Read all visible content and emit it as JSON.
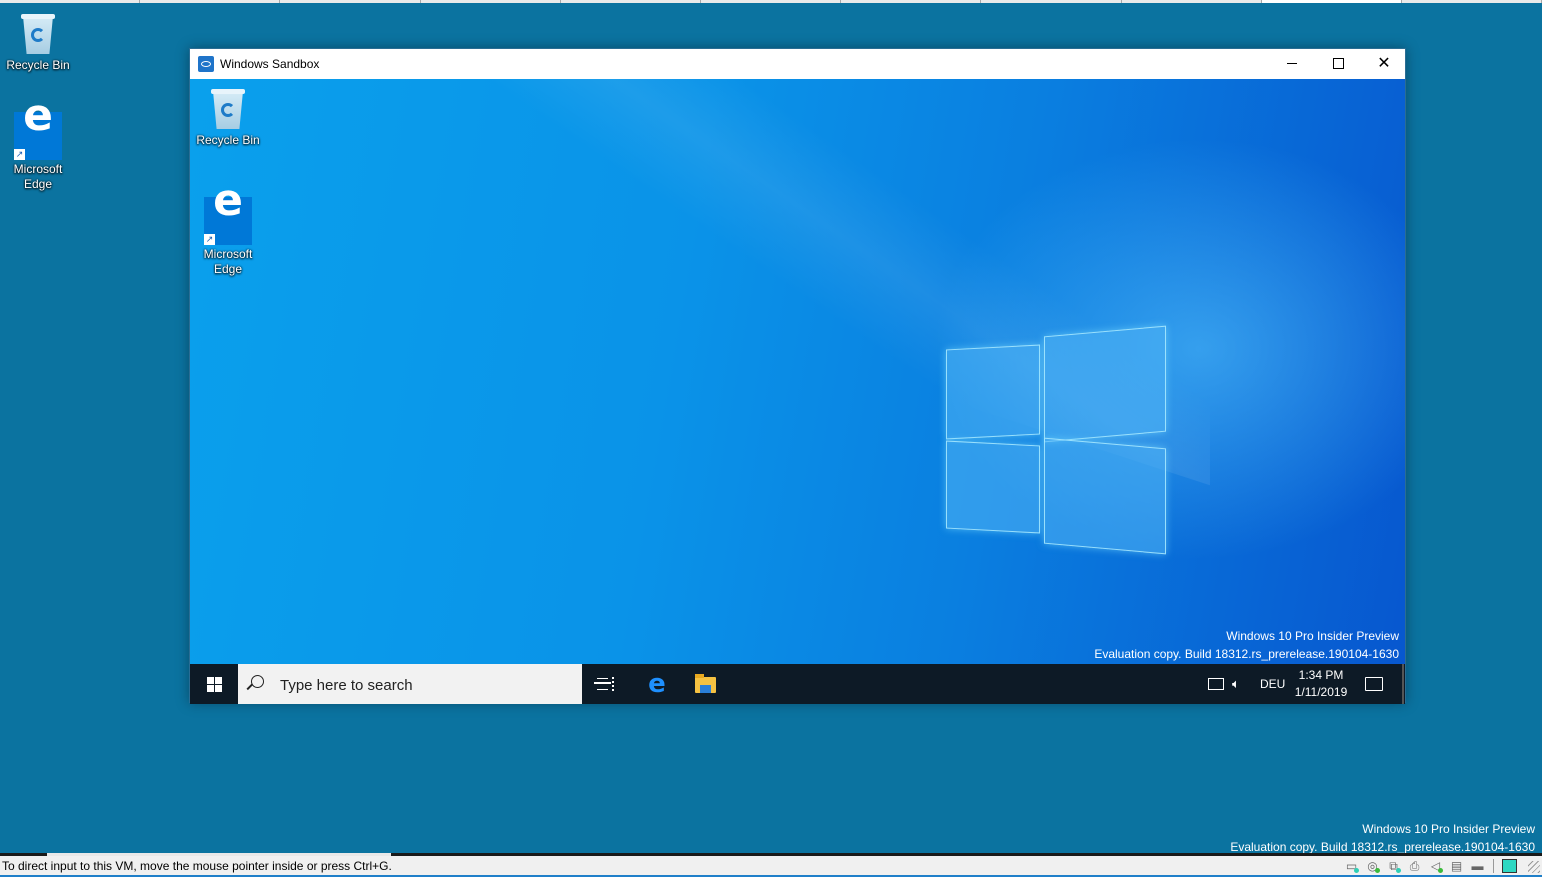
{
  "host_desktop": {
    "icons": [
      {
        "label": "Recycle Bin",
        "icon": "recycle-bin-icon"
      },
      {
        "label": "Microsoft Edge",
        "label_lines": [
          "Microsoft",
          "Edge"
        ],
        "icon": "edge-icon"
      }
    ],
    "watermark": {
      "line1": "Windows 10 Pro Insider Preview",
      "line2": "Evaluation copy. Build 18312.rs_prerelease.190104-1630"
    }
  },
  "sandbox_window": {
    "title": "Windows Sandbox",
    "buttons": {
      "minimize": "minimize",
      "maximize": "maximize",
      "close": "close"
    },
    "guest_desktop": {
      "icons": [
        {
          "label": "Recycle Bin",
          "icon": "recycle-bin-icon"
        },
        {
          "label": "Microsoft Edge",
          "label_lines": [
            "Microsoft",
            "Edge"
          ],
          "icon": "edge-icon"
        }
      ],
      "watermark": {
        "line1": "Windows 10 Pro Insider Preview",
        "line2": "Evaluation copy. Build 18312.rs_prerelease.190104-1630"
      }
    },
    "taskbar": {
      "search_placeholder": "Type here to search",
      "pinned": [
        "task-view",
        "microsoft-edge",
        "file-explorer"
      ],
      "tray": {
        "language": "DEU",
        "time": "1:34 PM",
        "date": "1/11/2019"
      }
    }
  },
  "status_bar": {
    "message": "To direct input to this VM, move the mouse pointer inside or press Ctrl+G.",
    "icons": [
      "hard-disk-icon",
      "optical-drive-icon",
      "network-icon",
      "printer-icon",
      "audio-icon",
      "floppy-icon",
      "usb-icon",
      "notes-icon"
    ]
  },
  "colors": {
    "host_desktop": "#0b73a0",
    "guest_accent": "#0a93e8",
    "taskbar": "#0d1a26",
    "statusbar_accent": "#1f7fc9"
  }
}
